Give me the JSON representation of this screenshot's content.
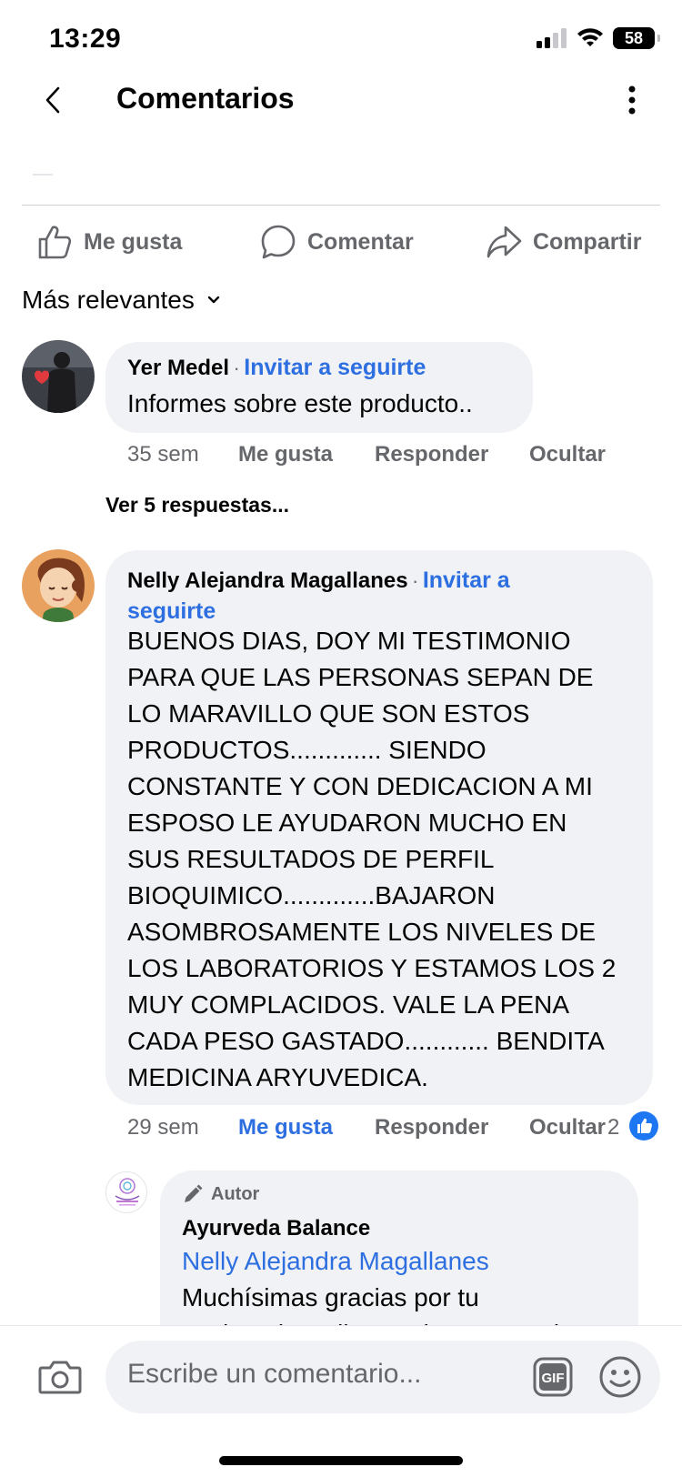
{
  "status": {
    "time": "13:29",
    "battery": "58"
  },
  "header": {
    "title": "Comentarios"
  },
  "actions": {
    "like": "Me gusta",
    "comment": "Comentar",
    "share": "Compartir"
  },
  "sort": {
    "label": "Más relevantes"
  },
  "comments": [
    {
      "author": "Yer Medel",
      "dot": "·",
      "invite": "Invitar a seguirte",
      "text": "Informes sobre este producto..",
      "time": "35 sem",
      "like": "Me gusta",
      "reply": "Responder",
      "hide": "Ocultar",
      "replies_link": "Ver 5 respuestas..."
    },
    {
      "author": "Nelly Alejandra Magallanes",
      "dot": "·",
      "invite": "Invitar a seguirte",
      "invite_line1": "Invitar a",
      "invite_line2": "seguirte",
      "text_lines": [
        "BUENOS DIAS, DOY MI TESTIMONIO",
        "PARA QUE LAS PERSONAS SEPAN DE",
        "LO MARAVILLO QUE SON ESTOS",
        "PRODUCTOS............. SIENDO",
        "CONSTANTE Y CON DEDICACION A MI",
        "ESPOSO LE AYUDARON MUCHO EN",
        "SUS RESULTADOS DE PERFIL",
        "BIOQUIMICO.............BAJARON",
        "ASOMBROSAMENTE LOS NIVELES DE",
        "LOS LABORATORIOS Y ESTAMOS LOS 2",
        "MUY COMPLACIDOS. VALE LA PENA",
        "CADA PESO GASTADO............ BENDITA",
        "MEDICINA ARYUVEDICA."
      ],
      "time": "29 sem",
      "like": "Me gusta",
      "reply": "Responder",
      "hide": "Ocultar",
      "reaction_count": "2"
    }
  ],
  "reply": {
    "badge": "Autor",
    "author": "Ayurveda Balance",
    "mention": "Nelly Alejandra Magallanes",
    "text_line1": "Muchísimas gracias por tu",
    "text_line2": "testimonio Nelly, un abrazo grande"
  },
  "composer": {
    "placeholder": "Escribe un comentario..."
  },
  "colors": {
    "accent": "#2d6fe0",
    "bubble": "#f0f2f5",
    "secondary_text": "#65676b"
  }
}
